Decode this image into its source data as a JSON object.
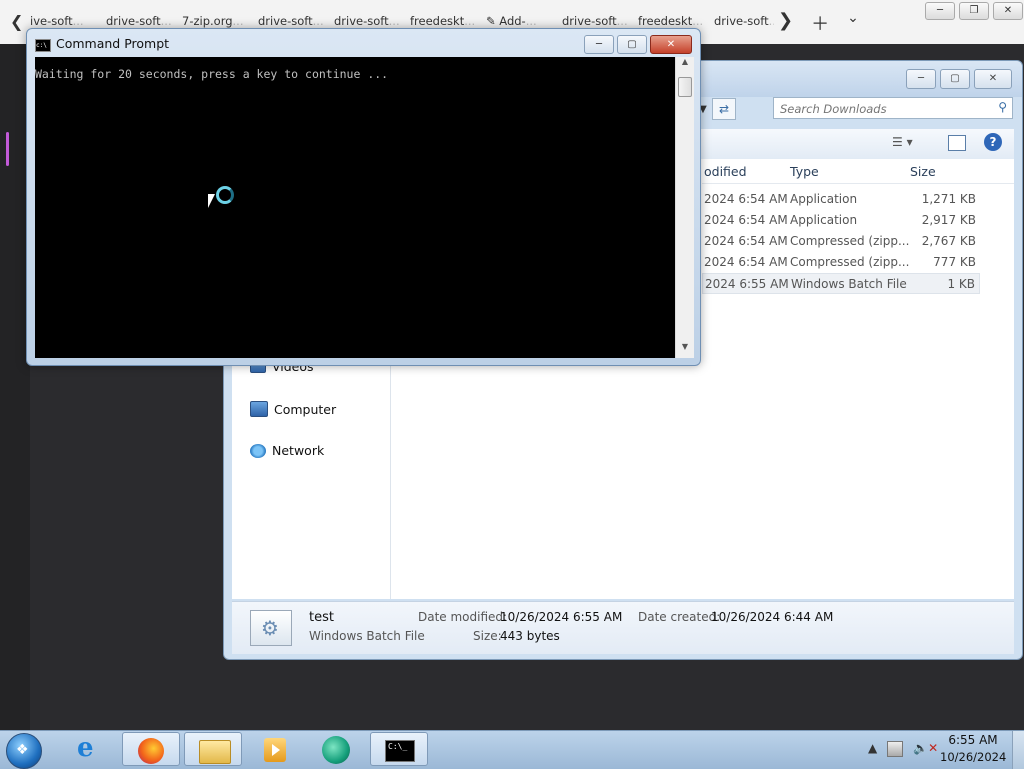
{
  "browser": {
    "tabs": [
      {
        "label": "ive-soft",
        "fade": "..."
      },
      {
        "label": "drive-soft",
        "fade": "..."
      },
      {
        "label": "7-zip.org",
        "fade": "..."
      },
      {
        "label": "drive-soft",
        "fade": "..."
      },
      {
        "label": "drive-soft",
        "fade": "..."
      },
      {
        "label": "freedeskt",
        "fade": "..."
      },
      {
        "label": "Add-",
        "fade": "..."
      },
      {
        "label": "drive-soft",
        "fade": "..."
      },
      {
        "label": "freedeskt",
        "fade": "..."
      },
      {
        "label": "drive-soft",
        "fade": "..."
      }
    ]
  },
  "explorer": {
    "search_placeholder": "Search Downloads",
    "nav": {
      "videos": "Videos",
      "computer": "Computer",
      "network": "Network"
    },
    "columns": {
      "modified": "odified",
      "type": "Type",
      "size": "Size"
    },
    "files": [
      {
        "modified": "2024 6:54 AM",
        "type": "Application",
        "size": "1,271 KB"
      },
      {
        "modified": "2024 6:54 AM",
        "type": "Application",
        "size": "2,917 KB"
      },
      {
        "modified": "2024 6:54 AM",
        "type": "Compressed (zipp...",
        "size": "2,767 KB"
      },
      {
        "modified": "2024 6:54 AM",
        "type": "Compressed (zipp...",
        "size": "777 KB"
      },
      {
        "modified": "2024 6:55 AM",
        "type": "Windows Batch File",
        "size": "1 KB"
      }
    ],
    "details": {
      "name": "test",
      "type": "Windows Batch File",
      "date_modified_label": "Date modified:",
      "date_modified": "10/26/2024 6:55 AM",
      "date_created_label": "Date created:",
      "date_created": "10/26/2024 6:44 AM",
      "size_label": "Size:",
      "size": "443 bytes"
    }
  },
  "cmd": {
    "title": "Command Prompt",
    "output": "Waiting for 20 seconds, press a key to continue ..."
  },
  "taskbar": {
    "time": "6:55 AM",
    "date": "10/26/2024"
  }
}
